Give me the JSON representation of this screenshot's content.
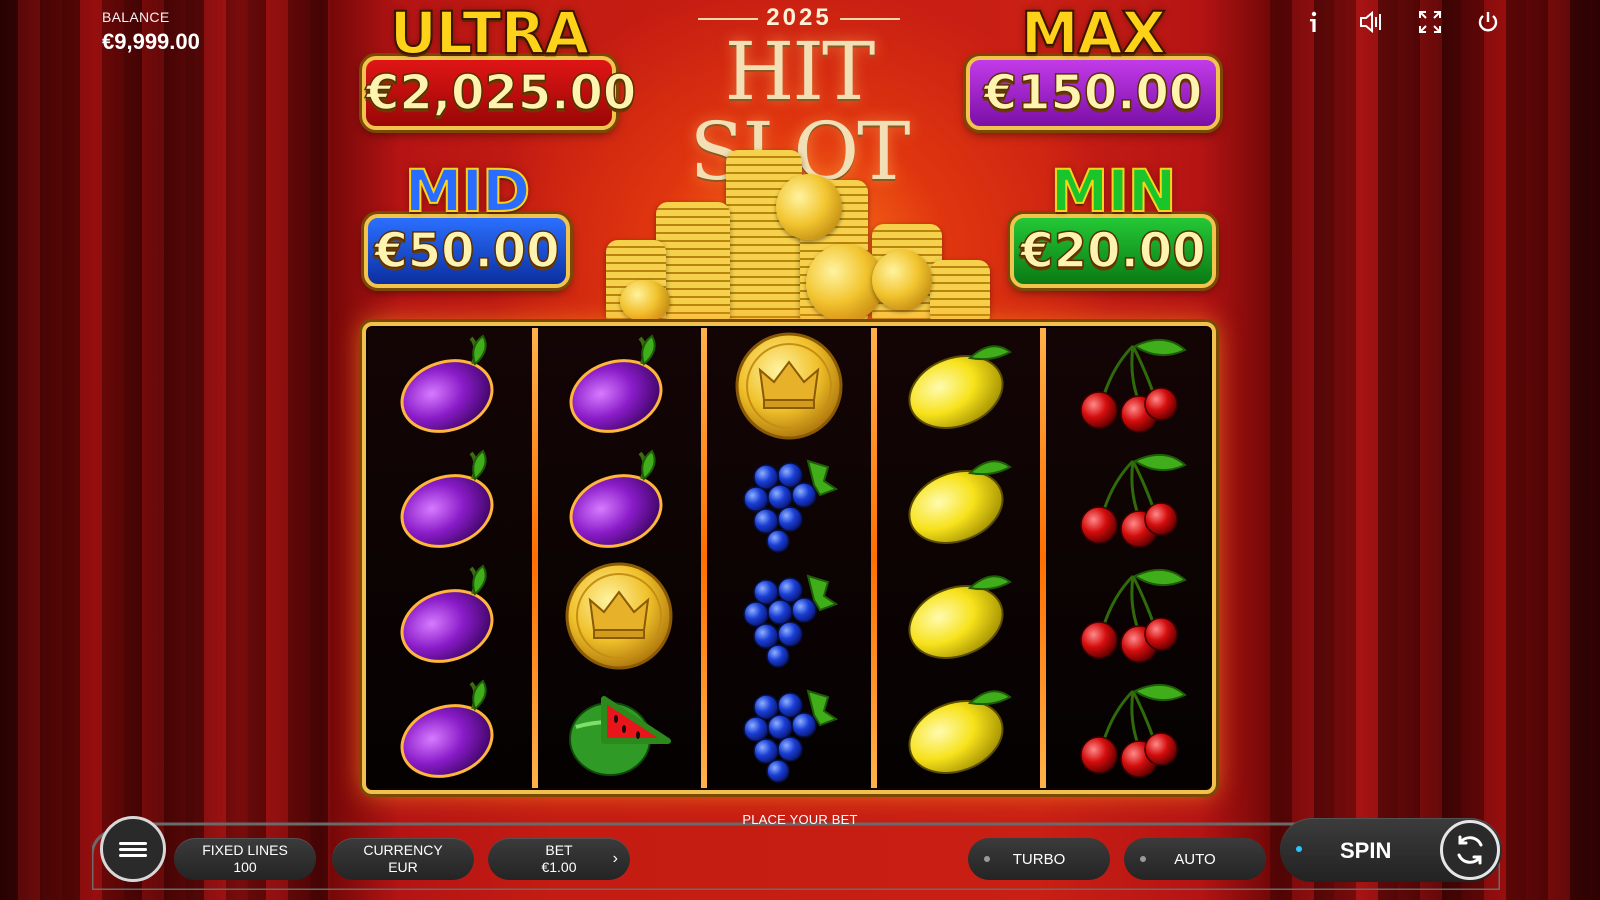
{
  "balance": {
    "label": "BALANCE",
    "value": "€9,999.00"
  },
  "logo": {
    "year": "2025",
    "title": "HIT SLOT"
  },
  "jackpots": {
    "ultra": {
      "title": "ULTRA",
      "amount": "€2,025.00"
    },
    "max": {
      "title": "MAX",
      "amount": "€150.00"
    },
    "mid": {
      "title": "MID",
      "amount": "€50.00"
    },
    "min": {
      "title": "MIN",
      "amount": "€20.00"
    }
  },
  "top_icons": [
    "info-icon",
    "sound-icon",
    "fullscreen-icon",
    "power-icon"
  ],
  "reels": [
    [
      "plum",
      "plum",
      "plum",
      "plum"
    ],
    [
      "plum",
      "plum",
      "crown-coin",
      "watermelon"
    ],
    [
      "crown-coin",
      "grapes",
      "grapes",
      "grapes"
    ],
    [
      "lemon",
      "lemon",
      "lemon",
      "lemon"
    ],
    [
      "cherry",
      "cherry",
      "cherry",
      "cherry"
    ]
  ],
  "status": "PLACE YOUR BET",
  "controls": {
    "fixed_lines": {
      "label": "FIXED LINES",
      "value": "100"
    },
    "currency": {
      "label": "CURRENCY",
      "value": "EUR"
    },
    "bet": {
      "label": "BET",
      "value": "€1.00"
    },
    "turbo": "TURBO",
    "auto": "AUTO",
    "spin": "SPIN"
  },
  "colors": {
    "accent_gold": "#f1c14b",
    "spin_indicator": "#29c7ff",
    "curtain_red": "#c41c12"
  }
}
